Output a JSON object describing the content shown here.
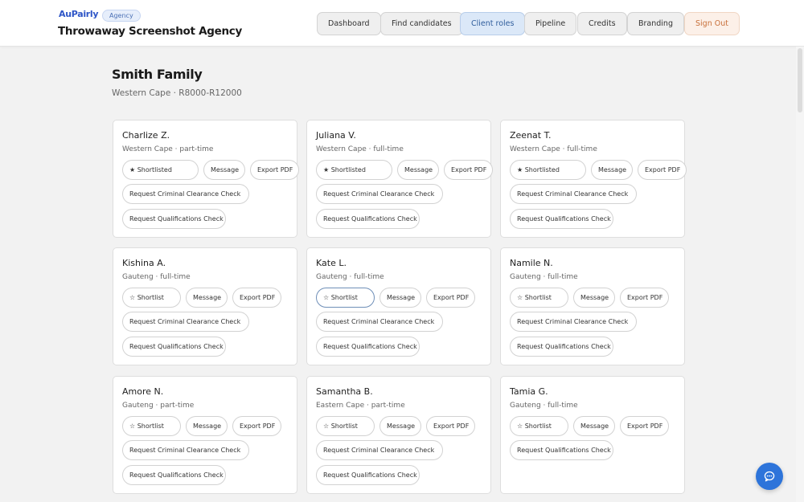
{
  "header": {
    "logo_text": "AuPairly",
    "badge": "Agency",
    "agency_name": "Throwaway Screenshot Agency"
  },
  "nav": [
    {
      "label": "Dashboard",
      "active": false
    },
    {
      "label": "Find candidates",
      "active": false
    },
    {
      "label": "Client roles",
      "active": true
    },
    {
      "label": "Pipeline",
      "active": false
    },
    {
      "label": "Credits",
      "active": false
    },
    {
      "label": "Branding",
      "active": false
    },
    {
      "label": "Sign Out",
      "active": false
    }
  ],
  "family": {
    "title": "Smith Family",
    "subtitle": "Western Cape · R8000-R12000"
  },
  "actions": {
    "message": "Message",
    "export": "Export PDF",
    "criminal_check": "Request Criminal Clearance Check",
    "qualifications_check": "Request Qualifications Check"
  },
  "candidates": [
    {
      "name": "Charlize Z.",
      "meta": "Western Cape · part-time",
      "shortlist_label": "★ Shortlisted",
      "shortlisted": true
    },
    {
      "name": "Juliana V.",
      "meta": "Western Cape · full-time",
      "shortlist_label": "★ Shortlisted",
      "shortlisted": true
    },
    {
      "name": "Zeenat T.",
      "meta": "Western Cape · full-time",
      "shortlist_label": "★ Shortlisted",
      "shortlisted": true
    },
    {
      "name": "Kishina A.",
      "meta": "Gauteng · full-time",
      "shortlist_label": "☆ Shortlist",
      "shortlisted": false
    },
    {
      "name": "Kate L.",
      "meta": "Gauteng · full-time",
      "shortlist_label": "☆ Shortlist",
      "shortlisted": false
    },
    {
      "name": "Namile N.",
      "meta": "Gauteng · full-time",
      "shortlist_label": "☆ Shortlist",
      "shortlisted": false
    },
    {
      "name": "Amore N.",
      "meta": "Gauteng · part-time",
      "shortlist_label": "☆ Shortlist",
      "shortlisted": false
    },
    {
      "name": "Samantha B.",
      "meta": "Eastern Cape · part-time",
      "shortlist_label": "☆ Shortlist",
      "shortlisted": false
    },
    {
      "name": "Tamia G.",
      "meta": "Gauteng · full-time",
      "shortlist_label": "☆ Shortlist",
      "shortlisted": false
    }
  ],
  "icons": {
    "chat": "chat-bubble-icon"
  },
  "colors": {
    "accent": "#2d74da",
    "active_nav_bg": "#dbe8f8",
    "signout_text": "#c8703a"
  }
}
